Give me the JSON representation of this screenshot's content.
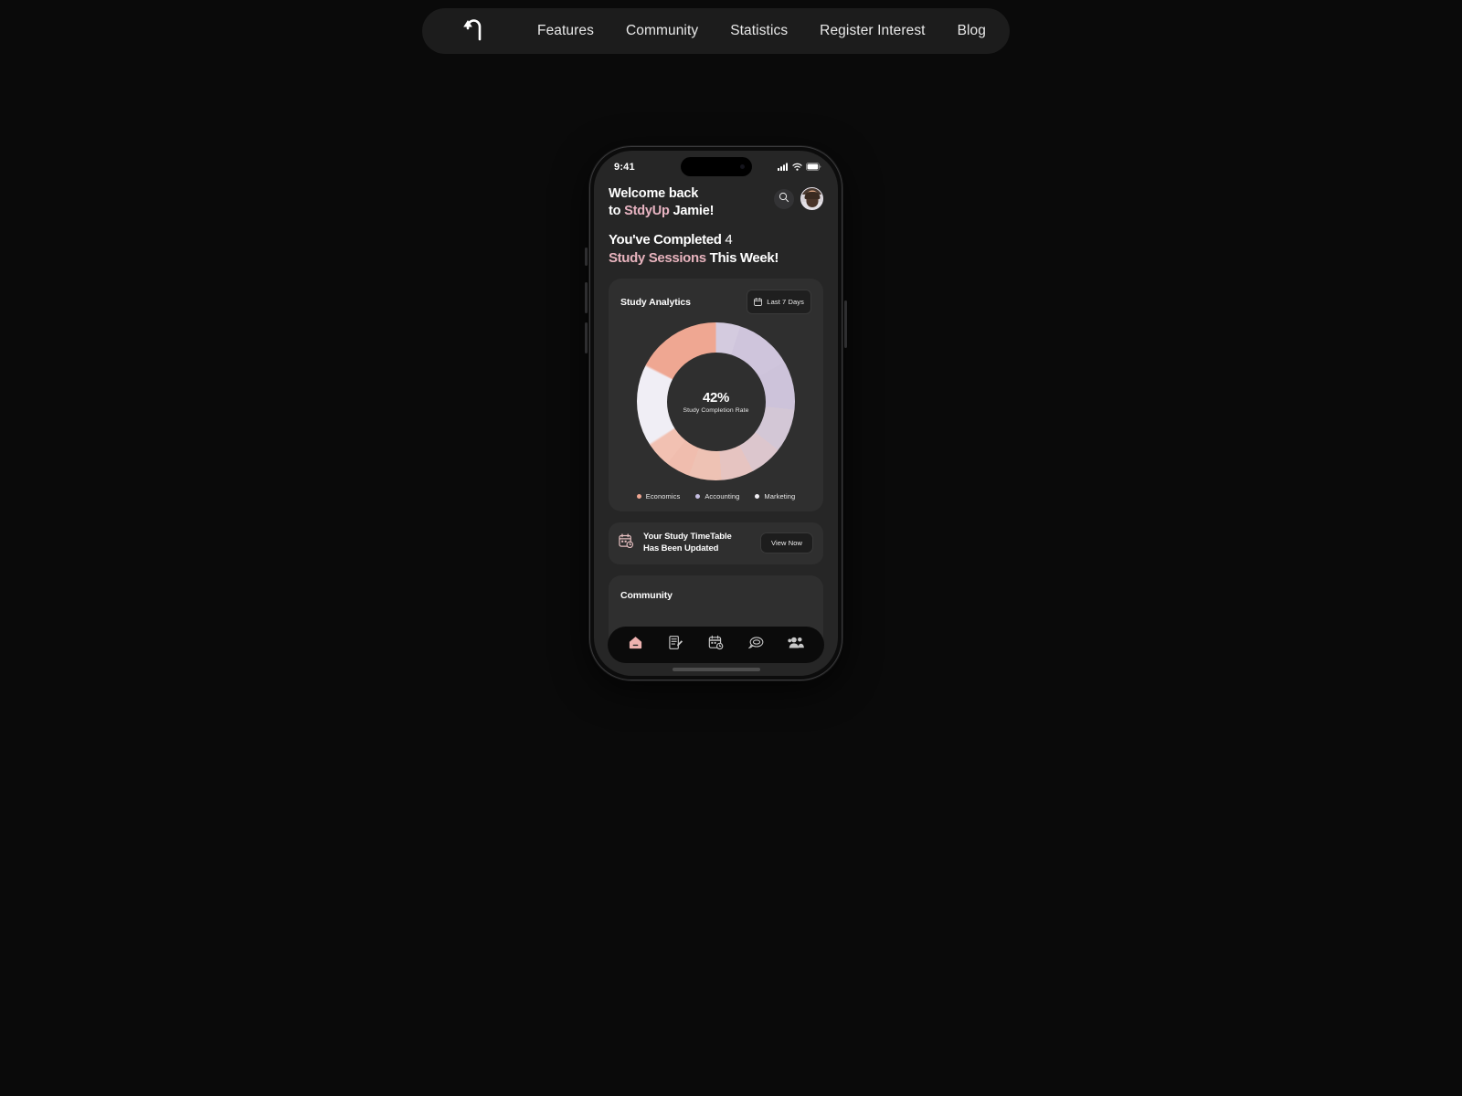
{
  "navbar": {
    "logo_icon": "u-turn-arrow-icon",
    "links": [
      {
        "label": "Features"
      },
      {
        "label": "Community"
      },
      {
        "label": "Statistics"
      },
      {
        "label": "Register Interest"
      },
      {
        "label": "Blog"
      }
    ]
  },
  "phone": {
    "status": {
      "time": "9:41",
      "cellular_icon": "cellular-signal-icon",
      "wifi_icon": "wifi-icon",
      "battery_icon": "battery-full-icon"
    },
    "header": {
      "welcome_line1": "Welcome back",
      "welcome_prefix": "to ",
      "brand": "StdyUp",
      "welcome_suffix": " Jamie!",
      "search_icon": "search-icon",
      "avatar_alt": "user-avatar"
    },
    "headline": {
      "line1_bold": "You've Completed ",
      "line1_num": "4",
      "line2_pink": "Study Sessions",
      "line2_rest": " This Week!"
    },
    "analytics": {
      "title": "Study Analytics",
      "range_label": "Last 7 Days",
      "range_icon": "calendar-icon",
      "center_value": "42%",
      "center_label": "Study Completion Rate"
    },
    "timetable": {
      "icon": "calendar-clock-icon",
      "line1": "Your Study TimeTable",
      "line2": "Has Been Updated",
      "button_label": "View Now"
    },
    "community": {
      "title": "Community"
    },
    "tabbar": [
      {
        "icon": "home-icon",
        "active": true
      },
      {
        "icon": "notes-edit-icon",
        "active": false
      },
      {
        "icon": "calendar-schedule-icon",
        "active": false
      },
      {
        "icon": "chat-bubble-icon",
        "active": false
      },
      {
        "icon": "people-group-icon",
        "active": false
      }
    ]
  },
  "chart_data": {
    "type": "pie",
    "title": "Study Analytics",
    "subtitle": "Study Completion Rate",
    "center_value": 42,
    "center_value_label": "42%",
    "categories": [
      "Economics",
      "Accounting",
      "Marketing"
    ],
    "values": [
      34,
      50,
      16
    ],
    "colors": [
      "#efa792",
      "#cfc5dc",
      "#f0eef5"
    ],
    "legend": [
      {
        "label": "Economics",
        "color": "#efa792"
      },
      {
        "label": "Accounting",
        "color": "#c4bde0"
      },
      {
        "label": "Marketing",
        "color": "#f1eff4"
      }
    ],
    "legend_position": "bottom",
    "grid": false,
    "donut": true,
    "time_range": "Last 7 Days"
  }
}
